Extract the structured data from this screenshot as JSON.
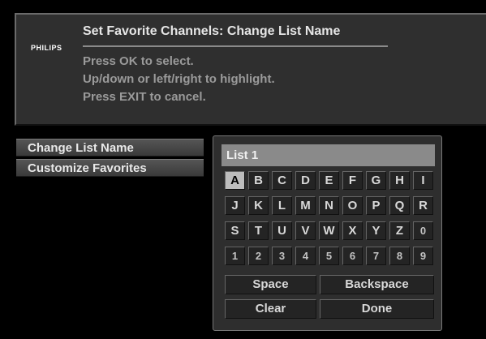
{
  "header": {
    "brand": "PHILIPS",
    "title": "Set Favorite Channels: Change List Name",
    "instructions": [
      "Press OK to select.",
      "Up/down or left/right to highlight.",
      "Press EXIT to cancel."
    ]
  },
  "menu": {
    "items": [
      {
        "label": "Change List Name"
      },
      {
        "label": "Customize Favorites"
      }
    ]
  },
  "keyboard": {
    "field_value": "List 1",
    "selected_key": "A",
    "rows": [
      [
        "A",
        "B",
        "C",
        "D",
        "E",
        "F",
        "G",
        "H",
        "I"
      ],
      [
        "J",
        "K",
        "L",
        "M",
        "N",
        "O",
        "P",
        "Q",
        "R"
      ],
      [
        "S",
        "T",
        "U",
        "V",
        "W",
        "X",
        "Y",
        "Z",
        "0"
      ],
      [
        "1",
        "2",
        "3",
        "4",
        "5",
        "6",
        "7",
        "8",
        "9"
      ]
    ],
    "space_label": "Space",
    "backspace_label": "Backspace",
    "clear_label": "Clear",
    "done_label": "Done"
  }
}
